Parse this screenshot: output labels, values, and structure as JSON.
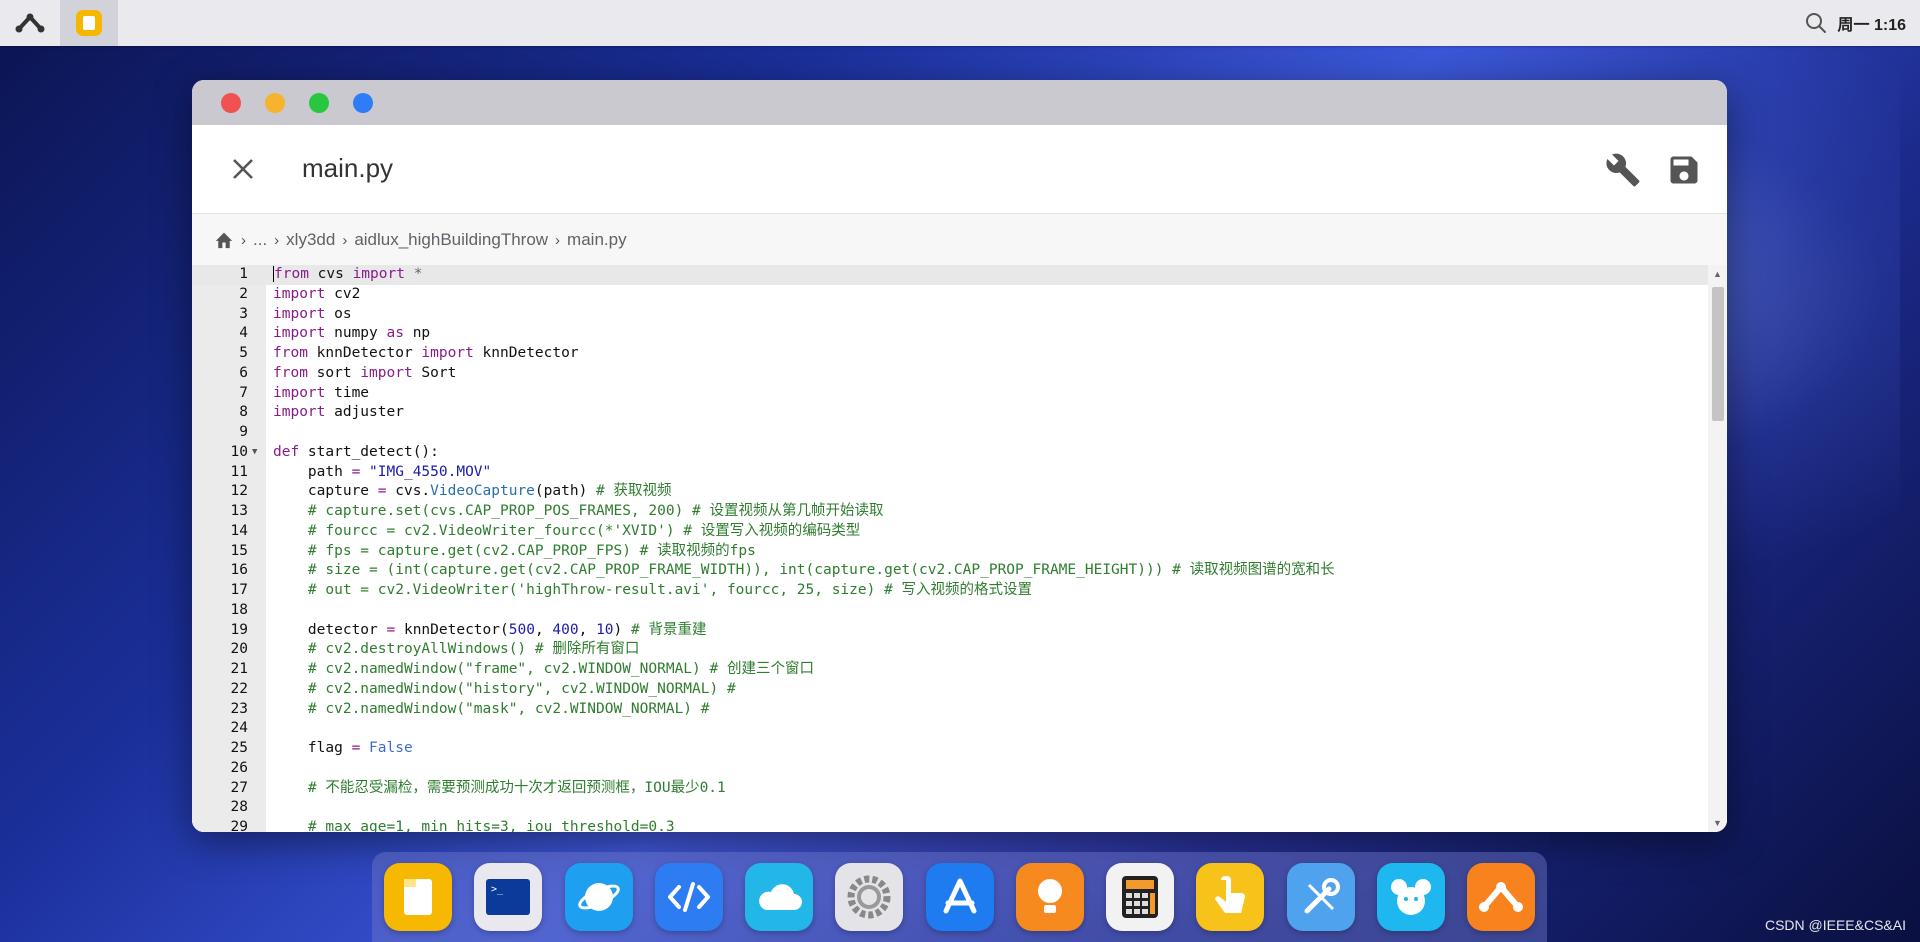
{
  "topbar": {
    "clock": "周一 1:16"
  },
  "window": {
    "file_name": "main.py",
    "traffic_colors": [
      "#f05151",
      "#f5b32e",
      "#27c840",
      "#2f7df6"
    ]
  },
  "breadcrumb": {
    "items": [
      "...",
      "xly3dd",
      "aidlux_highBuildingThrow",
      "main.py"
    ]
  },
  "code": {
    "lines": [
      {
        "n": "1",
        "h": "<span class=\"cursor\"></span><span class=\"kw\">from</span> cvs <span class=\"kw\">import</span> <span class=\"cm\" style=\"color:#666\">*</span>"
      },
      {
        "n": "2",
        "h": "<span class=\"kw\">import</span> cv2"
      },
      {
        "n": "3",
        "h": "<span class=\"kw\">import</span> os"
      },
      {
        "n": "4",
        "h": "<span class=\"kw\">import</span> numpy <span class=\"kw\">as</span> np"
      },
      {
        "n": "5",
        "h": "<span class=\"kw\">from</span> knnDetector <span class=\"kw\">import</span> knnDetector"
      },
      {
        "n": "6",
        "h": "<span class=\"kw\">from</span> sort <span class=\"kw\">import</span> Sort"
      },
      {
        "n": "7",
        "h": "<span class=\"kw\">import</span> time"
      },
      {
        "n": "8",
        "h": "<span class=\"kw\">import</span> adjuster"
      },
      {
        "n": "9",
        "h": ""
      },
      {
        "n": "10",
        "fold": true,
        "h": "<span class=\"kw\">def</span> start_detect():"
      },
      {
        "n": "11",
        "h": "    path <span class=\"kw\">=</span> <span class=\"str\">\"IMG_4550.MOV\"</span>"
      },
      {
        "n": "12",
        "h": "    capture <span class=\"kw\">=</span> cvs.<span class=\"fn\">VideoCapture</span>(path) <span class=\"cm\"># 获取视频</span>"
      },
      {
        "n": "13",
        "h": "    <span class=\"cm\"># capture.set(cvs.CAP_PROP_POS_FRAMES, 200) # 设置视频从第几帧开始读取</span>"
      },
      {
        "n": "14",
        "h": "    <span class=\"cm\"># fourcc = cv2.VideoWriter_fourcc(*'XVID') # 设置写入视频的编码类型</span>"
      },
      {
        "n": "15",
        "h": "    <span class=\"cm\"># fps = capture.get(cv2.CAP_PROP_FPS) # 读取视频的fps</span>"
      },
      {
        "n": "16",
        "h": "    <span class=\"cm\"># size = (int(capture.get(cv2.CAP_PROP_FRAME_WIDTH)), int(capture.get(cv2.CAP_PROP_FRAME_HEIGHT))) # 读取视频图谱的宽和长</span>"
      },
      {
        "n": "17",
        "h": "    <span class=\"cm\"># out = cv2.VideoWriter('highThrow-result.avi', fourcc, 25, size) # 写入视频的格式设置</span>"
      },
      {
        "n": "18",
        "h": ""
      },
      {
        "n": "19",
        "h": "    detector <span class=\"kw\">=</span> knnDetector(<span class=\"num\">500</span>, <span class=\"num\">400</span>, <span class=\"num\">10</span>) <span class=\"cm\"># 背景重建</span>"
      },
      {
        "n": "20",
        "h": "    <span class=\"cm\"># cv2.destroyAllWindows() # 删除所有窗口</span>"
      },
      {
        "n": "21",
        "h": "    <span class=\"cm\"># cv2.namedWindow(\"frame\", cv2.WINDOW_NORMAL) # 创建三个窗口</span>"
      },
      {
        "n": "22",
        "h": "    <span class=\"cm\"># cv2.namedWindow(\"history\", cv2.WINDOW_NORMAL) #</span>"
      },
      {
        "n": "23",
        "h": "    <span class=\"cm\"># cv2.namedWindow(\"mask\", cv2.WINDOW_NORMAL) #</span>"
      },
      {
        "n": "24",
        "h": ""
      },
      {
        "n": "25",
        "h": "    flag <span class=\"kw\">=</span> <span class=\"str\" style=\"color:#3f6fc8\">False</span>"
      },
      {
        "n": "26",
        "h": ""
      },
      {
        "n": "27",
        "h": "    <span class=\"cm\"># 不能忍受漏检，需要预测成功十次才返回预测框，IOU最少0.1</span>"
      },
      {
        "n": "28",
        "h": ""
      },
      {
        "n": "29",
        "h": "    <span class=\"cm\"># max_age=1, min_hits=3, iou_threshold=0.3</span>"
      }
    ]
  },
  "dock": {
    "apps": [
      {
        "name": "files-icon",
        "bg": "#f6b800"
      },
      {
        "name": "terminal-icon",
        "bg": "#e8e8ee"
      },
      {
        "name": "browser-icon",
        "bg": "#1e9ff0"
      },
      {
        "name": "code-editor-icon",
        "bg": "#2d7cf2"
      },
      {
        "name": "cloud-icon",
        "bg": "#23b7e8"
      },
      {
        "name": "settings-icon",
        "bg": "#e4e4e8"
      },
      {
        "name": "app-store-icon",
        "bg": "#1e7cf0"
      },
      {
        "name": "tips-icon",
        "bg": "#f78a1e"
      },
      {
        "name": "calculator-icon",
        "bg": "#f2f2f2"
      },
      {
        "name": "touch-icon",
        "bg": "#f7c21a"
      },
      {
        "name": "tools-icon",
        "bg": "#4fa3ee"
      },
      {
        "name": "mouse-icon",
        "bg": "#1fb7ef"
      },
      {
        "name": "aidlux-icon",
        "bg": "#f7821e"
      }
    ]
  },
  "watermark": "CSDN @IEEE&CS&AI"
}
